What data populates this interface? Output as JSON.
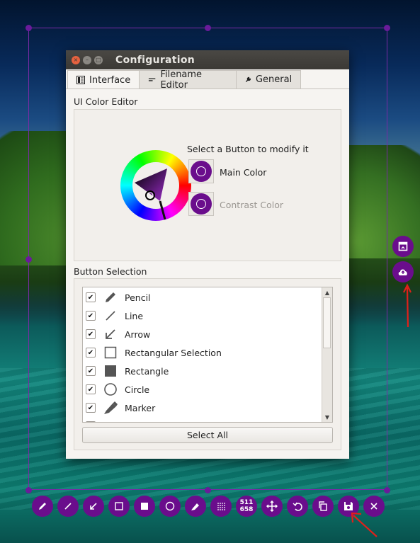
{
  "window": {
    "title": "Configuration",
    "controls": {
      "close": "×",
      "minimize": "–",
      "maximize": "□"
    }
  },
  "tabs": [
    {
      "label": "Interface",
      "icon": "interface-icon",
      "active": true
    },
    {
      "label": "Filename Editor",
      "icon": "filename-editor-icon",
      "active": false
    },
    {
      "label": "General",
      "icon": "wrench-icon",
      "active": false
    }
  ],
  "color_editor": {
    "group_label": "UI Color Editor",
    "instruction": "Select a Button to modify it",
    "main_color_label": "Main Color",
    "contrast_color_label": "Contrast Color",
    "main_color": "#6a0d8c"
  },
  "button_selection": {
    "group_label": "Button Selection",
    "items": [
      {
        "label": "Pencil",
        "icon": "pencil-icon",
        "checked": true
      },
      {
        "label": "Line",
        "icon": "line-icon",
        "checked": true
      },
      {
        "label": "Arrow",
        "icon": "arrow-icon",
        "checked": true
      },
      {
        "label": "Rectangular Selection",
        "icon": "rectangle-outline-icon",
        "checked": true
      },
      {
        "label": "Rectangle",
        "icon": "rectangle-filled-icon",
        "checked": true
      },
      {
        "label": "Circle",
        "icon": "circle-icon",
        "checked": true
      },
      {
        "label": "Marker",
        "icon": "marker-icon",
        "checked": true
      }
    ],
    "select_all_label": "Select All"
  },
  "toolbar": {
    "buttons": [
      {
        "name": "pencil-tool",
        "icon": "pencil-icon"
      },
      {
        "name": "line-tool",
        "icon": "line-icon"
      },
      {
        "name": "arrow-tool",
        "icon": "arrow-icon"
      },
      {
        "name": "rect-selection-tool",
        "icon": "rectangle-outline-icon"
      },
      {
        "name": "rectangle-tool",
        "icon": "rectangle-filled-icon"
      },
      {
        "name": "circle-tool",
        "icon": "circle-icon"
      },
      {
        "name": "marker-tool",
        "icon": "marker-icon"
      },
      {
        "name": "blur-tool",
        "icon": "blur-icon"
      },
      {
        "name": "size-indicator",
        "icon": "size-icon"
      },
      {
        "name": "move-tool",
        "icon": "move-icon"
      },
      {
        "name": "undo-tool",
        "icon": "undo-icon"
      },
      {
        "name": "copy-tool",
        "icon": "copy-icon"
      },
      {
        "name": "save-tool",
        "icon": "save-icon"
      },
      {
        "name": "close-tool",
        "icon": "close-icon"
      }
    ],
    "size_top": "511",
    "size_bottom": "658"
  },
  "side_buttons": [
    {
      "name": "open-app-button",
      "icon": "open-app-icon"
    },
    {
      "name": "upload-button",
      "icon": "cloud-upload-icon"
    }
  ],
  "accent_color": "#6a0d8c",
  "annotation_arrow_color": "#e0201a"
}
